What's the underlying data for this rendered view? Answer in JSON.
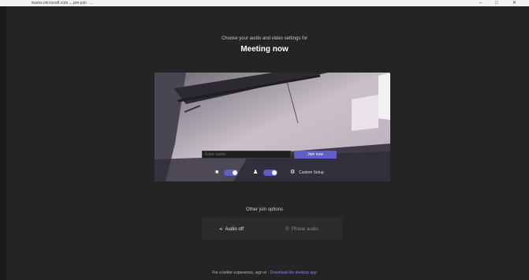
{
  "browser": {
    "url": "teams.microsoft.com ... pre-join · ...",
    "window_controls": [
      "–",
      "□",
      "✕"
    ]
  },
  "heading": {
    "subtitle": "Choose your audio and video settings for",
    "title": "Meeting now"
  },
  "prejoin": {
    "name_placeholder": "Enter name",
    "join_label": "Join now",
    "camera_on": true,
    "mic_on": true,
    "device_settings_label": "Custom Setup"
  },
  "other_join": {
    "label": "Other join options",
    "options": [
      {
        "label": "Audio off",
        "icon": "speaker-off-icon"
      },
      {
        "label": "Phone audio",
        "icon": "phone-icon"
      }
    ]
  },
  "footer": {
    "text": "For a better experience, sign in",
    "link": "Download the desktop app"
  },
  "colors": {
    "background": "#242424",
    "accent": "#5b5fc7",
    "panel": "#2b2b2b"
  }
}
